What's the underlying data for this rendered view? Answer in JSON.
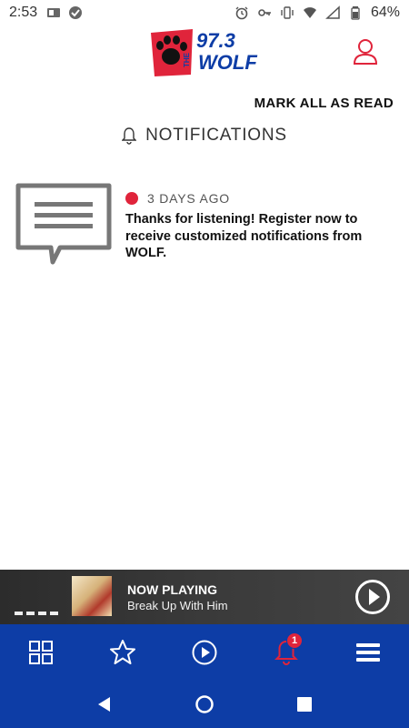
{
  "status_bar": {
    "time": "2:53",
    "battery": "64%"
  },
  "header": {
    "logo_text_top": "97.3",
    "logo_text_mid": "THE",
    "logo_text_bottom": "WOLF"
  },
  "actions": {
    "mark_all_read": "MARK ALL AS READ"
  },
  "notifications": {
    "title": "NOTIFICATIONS",
    "items": [
      {
        "time": "3 DAYS AGO",
        "message": "Thanks for listening! Register now to receive customized notifications from WOLF."
      }
    ]
  },
  "now_playing": {
    "label": "NOW PLAYING",
    "track": "Break Up With Him"
  },
  "tab_bar": {
    "notification_badge": "1"
  },
  "colors": {
    "brand_blue": "#0d3da6",
    "accent_red": "#e0243b"
  }
}
